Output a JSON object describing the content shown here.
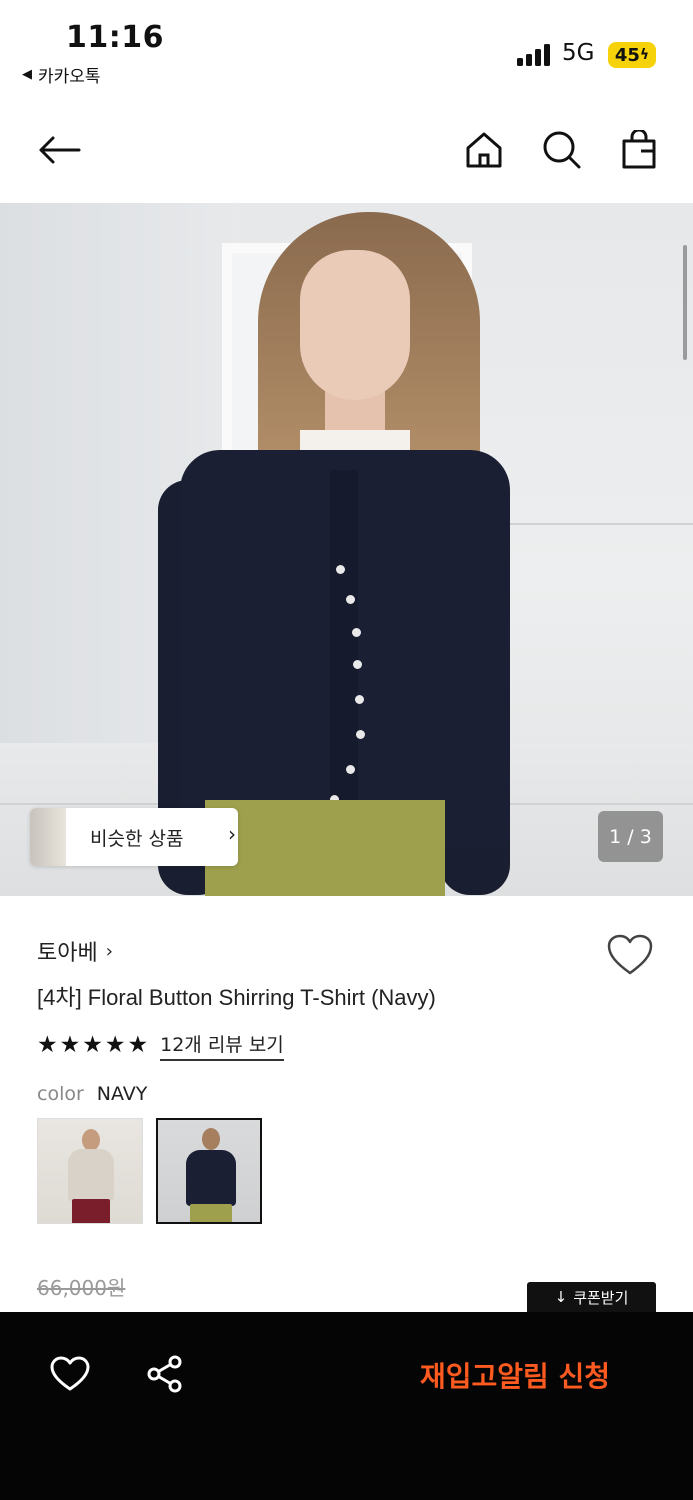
{
  "status_bar": {
    "time": "11:16",
    "back_app": "카카오톡",
    "network": "5G",
    "battery": "45"
  },
  "nav": {
    "icons": [
      "back-arrow-icon",
      "home-icon",
      "search-icon",
      "shopping-bag-icon"
    ]
  },
  "gallery": {
    "similar_label": "비슷한 상품",
    "page_indicator": "1 / 3"
  },
  "product": {
    "brand": "토아베",
    "title": "[4차] Floral Button Shirring T-Shirt (Navy)",
    "rating_stars": 5,
    "review_link": "12개 리뷰 보기",
    "color_label": "color",
    "color_value": "NAVY",
    "original_price": "66,000원",
    "coupon_label": "쿠폰받기"
  },
  "bottom_bar": {
    "restock_label": "재입고알림 신청"
  },
  "colors": {
    "accent": "#ff5a1f",
    "bar": "#050505",
    "battery": "#f5d20a"
  }
}
